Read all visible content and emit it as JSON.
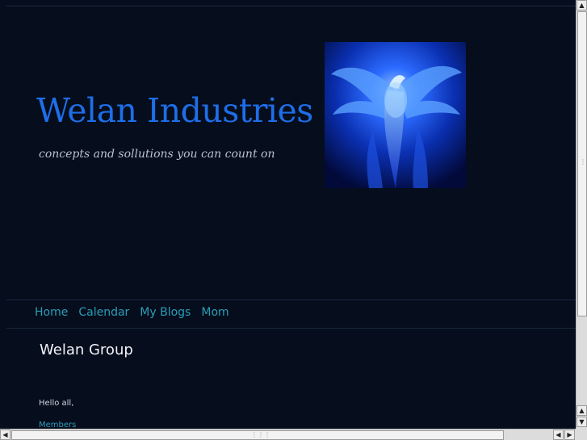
{
  "header": {
    "title": "Welan Industries",
    "tagline": "concepts and sollutions you can count on",
    "image_icon": "phoenix-flame-image"
  },
  "nav": {
    "items": [
      {
        "label": "Home"
      },
      {
        "label": "Calendar"
      },
      {
        "label": "My Blogs"
      },
      {
        "label": "Mom"
      }
    ]
  },
  "main": {
    "section_title": "Welan Group",
    "greeting": "Hello all,",
    "members_link": "Members"
  },
  "colors": {
    "background": "#060d1c",
    "title": "#1e6ee8",
    "link": "#2a9fb8"
  },
  "scrollbars": {
    "up_icon": "arrow-up-icon",
    "down_icon": "arrow-down-icon",
    "left_icon": "arrow-left-icon",
    "right_icon": "arrow-right-icon"
  }
}
